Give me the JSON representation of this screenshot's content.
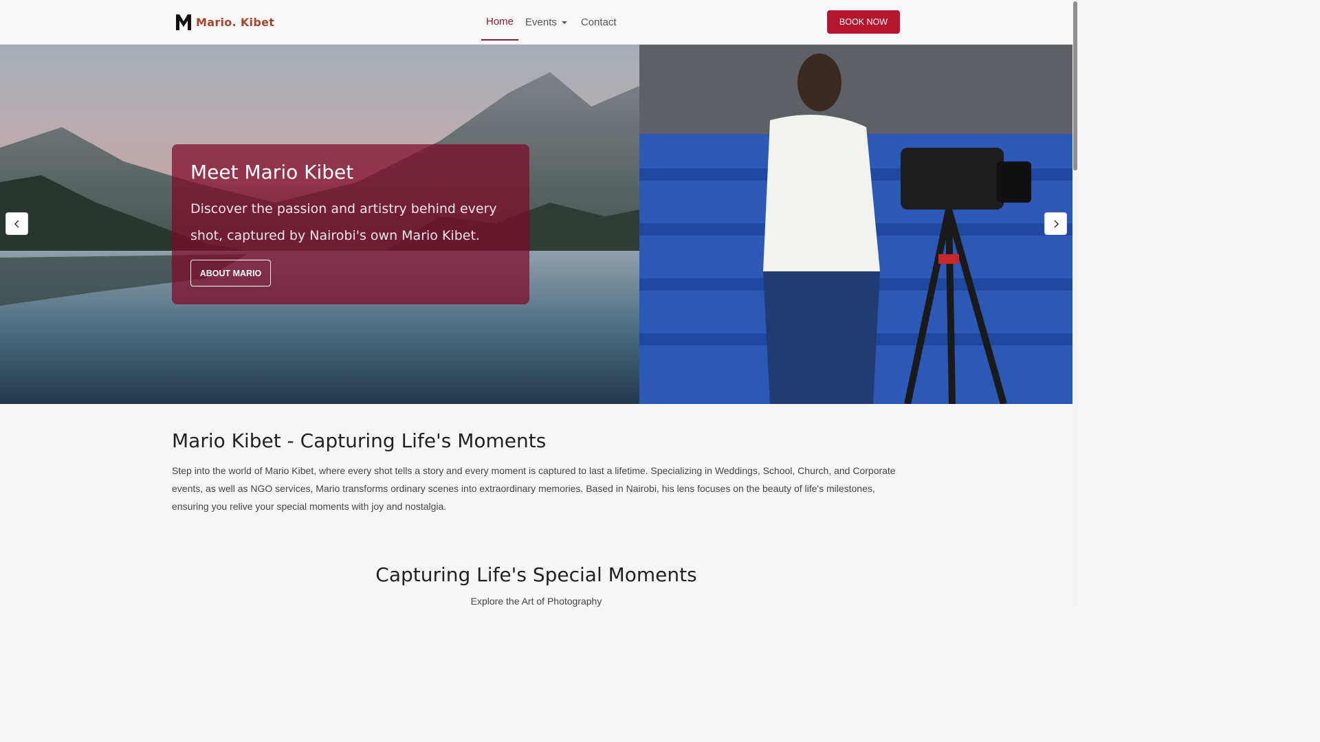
{
  "brand": {
    "name": "Mario. Kibet",
    "icon": "m-logo-icon",
    "color": "#a8432b"
  },
  "nav": {
    "items": [
      {
        "label": "Home",
        "active": true
      },
      {
        "label": "Events",
        "dropdown": true
      },
      {
        "label": "Contact"
      }
    ],
    "book_label": "BOOK NOW"
  },
  "hero": {
    "title": "Meet Mario Kibet",
    "text": "Discover the passion and artistry behind every shot, captured by Nairobi's own Mario Kibet.",
    "button_label": "ABOUT MARIO",
    "prev_icon": "chevron-left-icon",
    "next_icon": "chevron-right-icon"
  },
  "about": {
    "heading": "Mario Kibet - Capturing Life's Moments",
    "body": "Step into the world of Mario Kibet, where every shot tells a story and every moment is captured to last a lifetime. Specializing in Weddings, School, Church, and Corporate events, as well as NGO services, Mario transforms ordinary scenes into extraordinary memories. Based in Nairobi, his lens focuses on the beauty of life's milestones, ensuring you relive your special moments with joy and nostalgia."
  },
  "moments": {
    "heading": "Capturing Life's Special Moments",
    "subheading": "Explore the Art of Photography"
  },
  "colors": {
    "accent": "#b5152d",
    "overlay": "#800828",
    "active_nav": "#8c1c2c"
  }
}
